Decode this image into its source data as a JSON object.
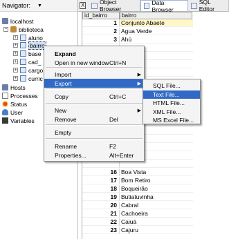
{
  "navigator": {
    "header_label": "Navigator:",
    "header_arrow": "▼",
    "tree": {
      "host": "localhost",
      "database": "biblioteca",
      "tables": [
        "aluno",
        "bairro",
        "base",
        "cad_",
        "cargo",
        "curric"
      ],
      "other_nodes": [
        "Hosts",
        "Processes",
        "Status",
        "User",
        "Variables"
      ]
    }
  },
  "tabs": {
    "close_symbol": "X",
    "items": [
      "Object Browser",
      "Data Browser",
      "SQL Editor"
    ],
    "active": "Data Browser"
  },
  "grid": {
    "columns": [
      "id_bairro",
      "bairro"
    ],
    "rows": [
      {
        "id": "1",
        "name": "Conjunto Abaete"
      },
      {
        "id": "2",
        "name": "Agua Verde"
      },
      {
        "id": "3",
        "name": "Ahú"
      },
      {
        "id": "",
        "name": "queirão"
      },
      {
        "id": "",
        "name": ""
      },
      {
        "id": "",
        "name": "ória"
      },
      {
        "id": "",
        "name": "V"
      },
      {
        "id": "",
        "name": ""
      },
      {
        "id": "",
        "name": ""
      },
      {
        "id": "",
        "name": ""
      },
      {
        "id": "",
        "name": ""
      },
      {
        "id": "",
        "name": ""
      },
      {
        "id": "",
        "name": ""
      },
      {
        "id": "",
        "name": ""
      },
      {
        "id": "",
        "name": "a"
      },
      {
        "id": "",
        "name": ""
      },
      {
        "id": "",
        "name": ""
      },
      {
        "id": "",
        "name": ""
      },
      {
        "id": "16",
        "name": "Boa Vista"
      },
      {
        "id": "17",
        "name": "Bom Retiro"
      },
      {
        "id": "18",
        "name": "Boqueirão"
      },
      {
        "id": "19",
        "name": "Butiatuvinha"
      },
      {
        "id": "20",
        "name": "Cabral"
      },
      {
        "id": "21",
        "name": "Cachoeira"
      },
      {
        "id": "22",
        "name": "Caiuá"
      },
      {
        "id": "23",
        "name": "Cajuru"
      }
    ]
  },
  "context_menu": {
    "items": [
      {
        "label": "Expand",
        "shortcut": "",
        "submenu": false
      },
      {
        "label": "Open in new window",
        "shortcut": "Ctrl+N",
        "submenu": false
      },
      {
        "label": "Import",
        "shortcut": "",
        "submenu": true
      },
      {
        "label": "Export",
        "shortcut": "",
        "submenu": true
      },
      {
        "label": "Copy",
        "shortcut": "Ctrl+C",
        "submenu": false
      },
      {
        "label": "New",
        "shortcut": "",
        "submenu": true
      },
      {
        "label": "Remove",
        "shortcut": "Del",
        "submenu": false
      },
      {
        "label": "Empty",
        "shortcut": "",
        "submenu": false
      },
      {
        "label": "Rename",
        "shortcut": "F2",
        "submenu": false
      },
      {
        "label": "Properties...",
        "shortcut": "Alt+Enter",
        "submenu": false
      }
    ],
    "submenu_arrow": "▶"
  },
  "export_submenu": {
    "items": [
      "SQL File...",
      "Text File...",
      "HTML File...",
      "XML File...",
      "MS Excel File..."
    ],
    "highlighted": "Text File..."
  },
  "colors": {
    "highlight": "#316ac5",
    "menu_bg": "#f4f4f4",
    "first_cell_bg": "#fff7c8"
  }
}
